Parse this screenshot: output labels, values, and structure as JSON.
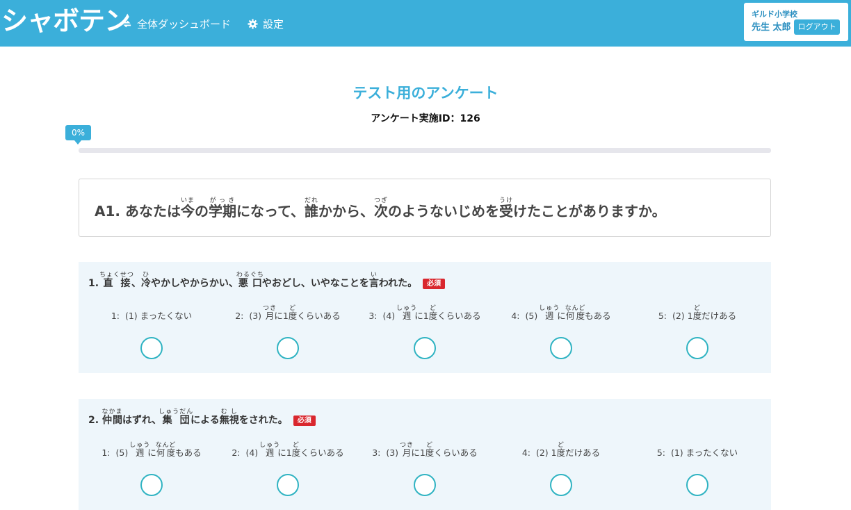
{
  "header": {
    "logo": "シャボテン",
    "nav": {
      "dashboard": "全体ダッシュボード",
      "settings": "設定"
    },
    "user": {
      "school": "ギルド小学校",
      "name": "先生 太郎",
      "logout": "ログアウト"
    }
  },
  "survey": {
    "title": "テスト用のアンケート",
    "id_label": "アンケート実施ID：126",
    "progress_label": "0%",
    "progress_value": 0
  },
  "section": {
    "prefix": "A1. "
  },
  "questions": [
    {
      "number": "1. ",
      "required": "必須",
      "options": [
        {
          "num": "1:",
          "code": "(1)"
        },
        {
          "num": "2:",
          "code": "(3)"
        },
        {
          "num": "3:",
          "code": "(4)"
        },
        {
          "num": "4:",
          "code": "(5)"
        },
        {
          "num": "5:",
          "code": "(2)"
        }
      ]
    },
    {
      "number": "2. ",
      "required": "必須",
      "options": [
        {
          "num": "1:",
          "code": "(5)"
        },
        {
          "num": "2:",
          "code": "(4)"
        },
        {
          "num": "3:",
          "code": "(3)"
        },
        {
          "num": "4:",
          "code": "(2)"
        },
        {
          "num": "5:",
          "code": "(1)"
        }
      ]
    }
  ],
  "colors": {
    "accent": "#3bafda",
    "required": "#d9272e",
    "card_bg": "#eef6fb",
    "radio_border": "#2fb3c2"
  }
}
